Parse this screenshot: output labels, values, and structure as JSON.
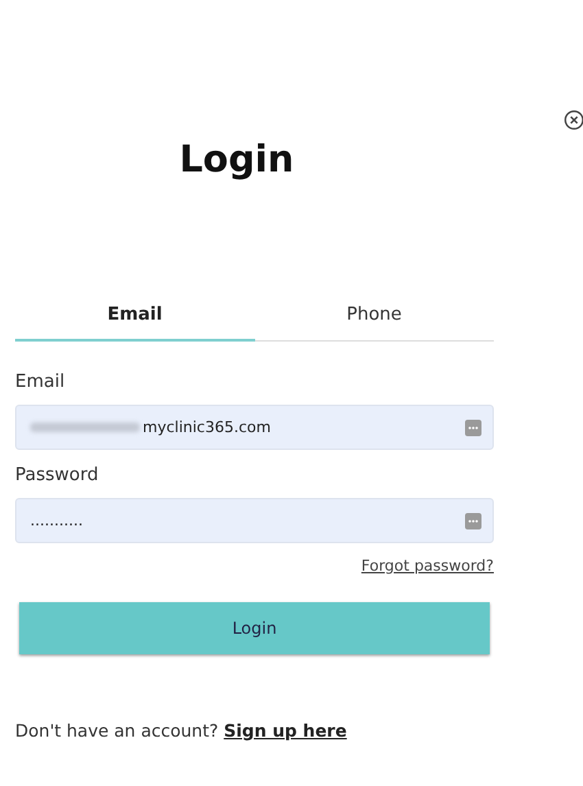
{
  "title": "Login",
  "tabs": [
    {
      "label": "Email",
      "selected": true
    },
    {
      "label": "Phone",
      "selected": false
    }
  ],
  "fields": [
    {
      "label": "Email",
      "value": "myclinic365.com",
      "redacted": true
    },
    {
      "label": "Password",
      "value": "...........",
      "redacted": false
    }
  ],
  "forgot_link": "Forgot password?",
  "submit_button": "Login",
  "signup": {
    "text": "Don't have an account?",
    "link": "Sign up here"
  }
}
